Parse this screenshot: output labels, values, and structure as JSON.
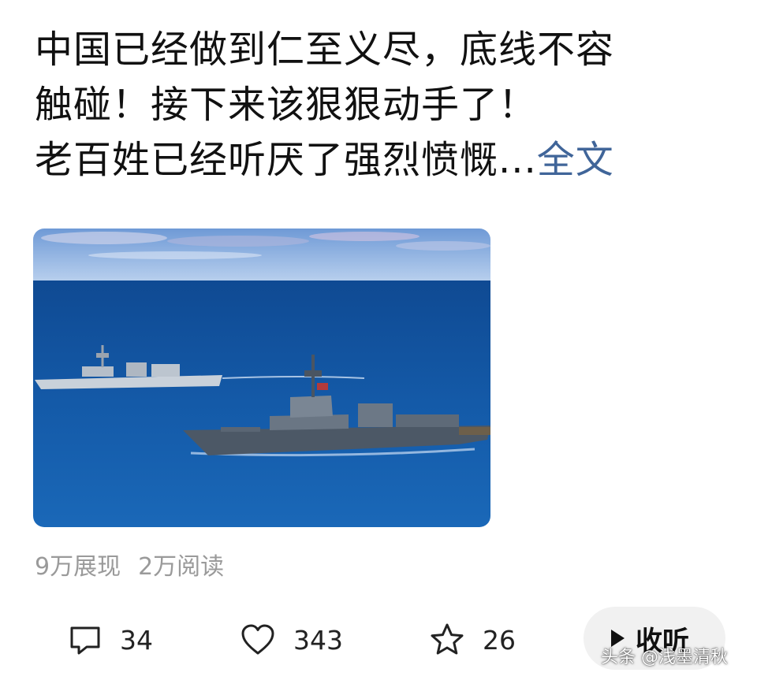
{
  "post": {
    "line1": "中国已经做到仁至义尽，底线不容",
    "line2": "触碰！接下来该狠狠动手了！",
    "line3": "老百姓已经听厌了强烈愤慨...",
    "full_text_link": "全文"
  },
  "image": {
    "subject": "two-warships-at-sea"
  },
  "stats": {
    "impressions": "9万展现",
    "reads": "2万阅读"
  },
  "actions": {
    "comments": "34",
    "likes": "343",
    "favorites": "26",
    "listen_label": "收听"
  },
  "watermark": "头条 @浅墨清秋",
  "colors": {
    "link": "#406599",
    "text": "#111111",
    "muted": "#9a9a9a",
    "listen_bg": "#f1f1f1"
  }
}
